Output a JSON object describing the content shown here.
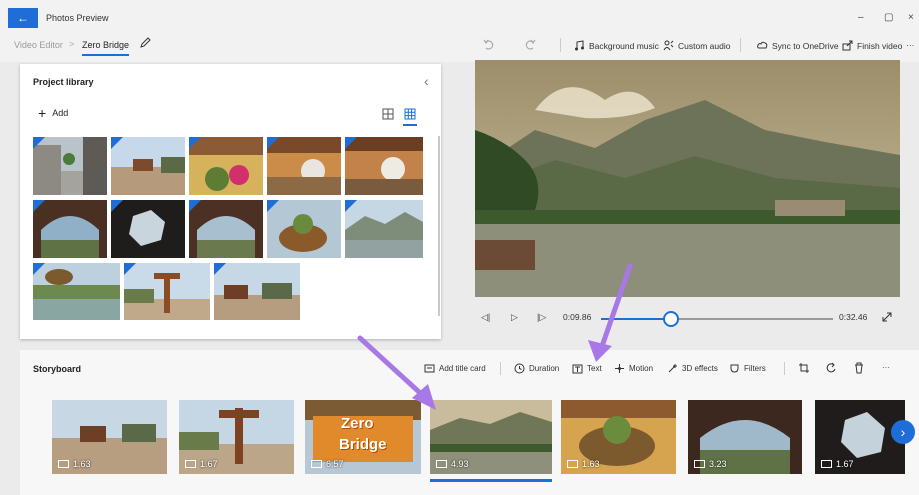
{
  "window": {
    "title": "Photos Preview",
    "controls": [
      "–",
      "▢",
      "×"
    ]
  },
  "breadcrumb": {
    "parent": "Video Editor",
    "separator": ">",
    "current": "Zero Bridge"
  },
  "toolbar": {
    "background_music": "Background music",
    "custom_audio": "Custom audio",
    "sync": "Sync to OneDrive",
    "finish_video": "Finish video",
    "more": "···"
  },
  "library": {
    "title": "Project library",
    "add_label": "Add",
    "collapse": "‹"
  },
  "transport": {
    "current_time": "0:09.86",
    "end_time": "0:32.46",
    "progress": 0.3
  },
  "storyboard": {
    "title": "Storyboard",
    "tools": {
      "add_title_card": "Add title card",
      "duration": "Duration",
      "text": "Text",
      "motion": "Motion",
      "effects_3d": "3D effects",
      "filters": "Filters"
    },
    "more": "···",
    "clips": [
      {
        "duration": "1.63"
      },
      {
        "duration": "1.67"
      },
      {
        "duration": "6.57",
        "overlay_text_1": "Zero",
        "overlay_text_2": "Bridge"
      },
      {
        "duration": "4.93"
      },
      {
        "duration": "1.63"
      },
      {
        "duration": "3.23"
      },
      {
        "duration": "1.67"
      }
    ]
  },
  "colors": {
    "accent": "#1f6dd6",
    "arrow": "#a878e6"
  }
}
